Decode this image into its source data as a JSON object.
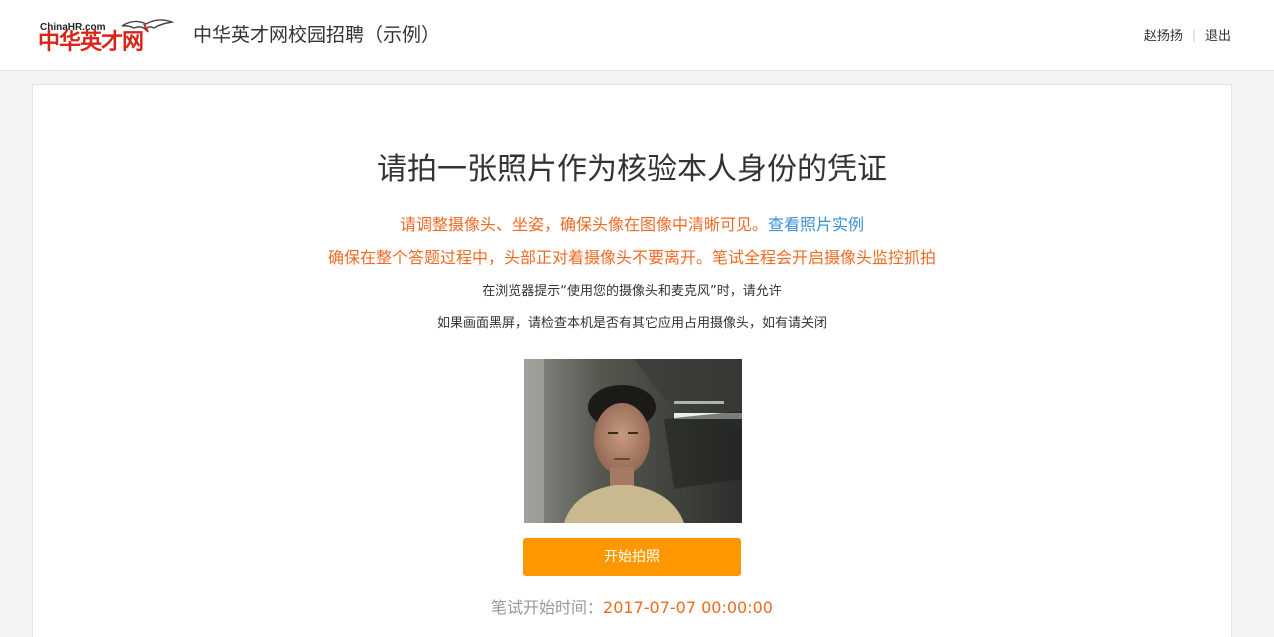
{
  "header": {
    "logo_small": "ChinaHR.com",
    "logo_big": "中华英才网",
    "site_title": "中华英才网校园招聘（示例）",
    "user_name": "赵扬扬",
    "separator": "|",
    "logout": "退出"
  },
  "main": {
    "title": "请拍一张照片作为核验本人身份的凭证",
    "tip1": "请调整摄像头、坐姿，确保头像在图像中清晰可见。",
    "tip1_link": "查看照片实例",
    "tip2": "确保在整个答题过程中，头部正对着摄像头不要离开。笔试全程会开启摄像头监控抓拍",
    "tip3": "在浏览器提示“使用您的摄像头和麦克风”时，请允许",
    "tip4": "如果画面黑屏，请检查本机是否有其它应用占用摄像头，如有请关闭",
    "capture_button": "开始拍照",
    "exam_time_label": "笔试开始时间：",
    "exam_time_value": "2017-07-07 00:00:00"
  },
  "colors": {
    "accent_orange": "#ff9800",
    "warning_text": "#ee6a24",
    "link_blue": "#3a8fd6",
    "logo_red": "#d9241b"
  }
}
